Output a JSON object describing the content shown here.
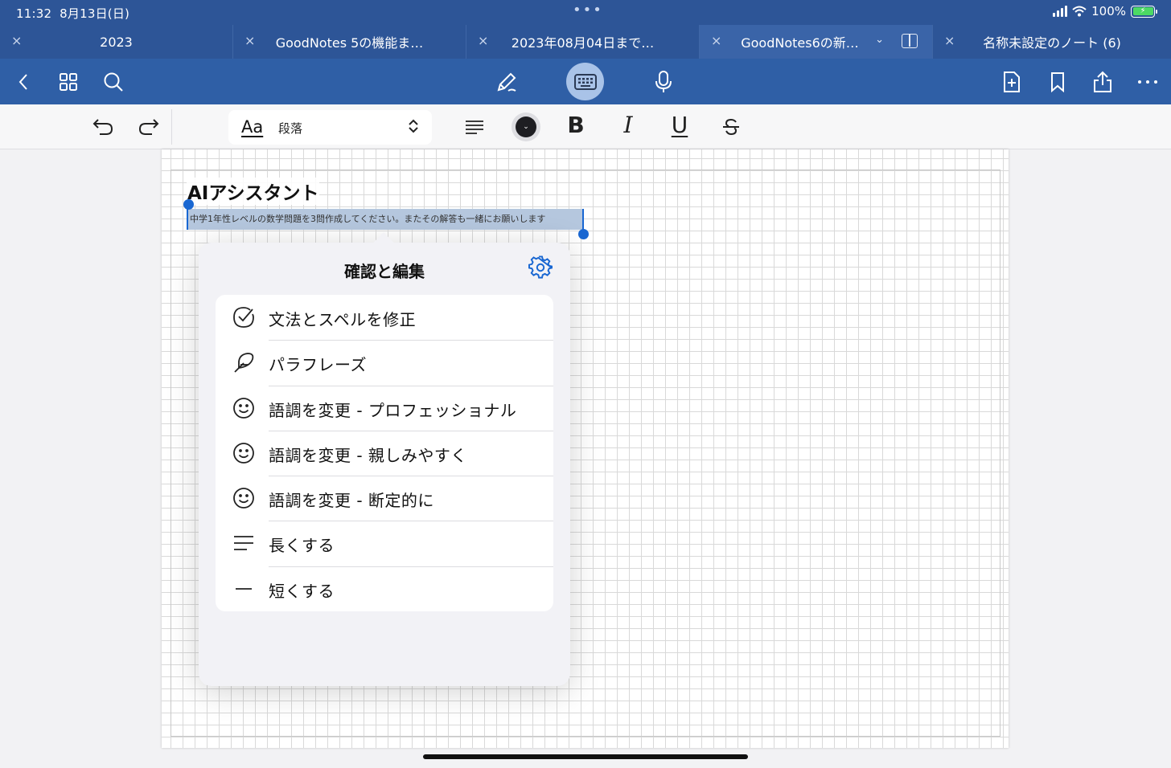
{
  "status_bar": {
    "time": "11:32",
    "date": "8月13日(日)",
    "dots": "•••",
    "battery": "100%"
  },
  "tabs": [
    {
      "label": "2023",
      "active": false
    },
    {
      "label": "GoodNotes 5の機能ま…",
      "active": false
    },
    {
      "label": "2023年08月04日まで…",
      "active": false
    },
    {
      "label": "GoodNotes6の新…",
      "active": true
    },
    {
      "label": "名称未設定のノート (6)",
      "active": false
    }
  ],
  "tab_close": "×",
  "toolbar": {
    "paragraph_style": "段落",
    "aa": "Aa",
    "bold": "B",
    "italic": "I",
    "underline": "U"
  },
  "note": {
    "title": "AIアシスタント",
    "selected_text": "中学1年性レベルの数学問題を3問作成してください。またその解答も一緒にお願いします"
  },
  "popover": {
    "title": "確認と編集",
    "items": [
      {
        "label": "文法とスペルを修正",
        "icon": "checkmark-circle-icon"
      },
      {
        "label": "パラフレーズ",
        "icon": "feather-icon"
      },
      {
        "label": "語調を変更 - プロフェッショナル",
        "icon": "smiley-icon"
      },
      {
        "label": "語調を変更 - 親しみやすく",
        "icon": "smiley-icon"
      },
      {
        "label": "語調を変更 - 断定的に",
        "icon": "smiley-icon"
      },
      {
        "label": "長くする",
        "icon": "lines-icon"
      },
      {
        "label": "短くする",
        "icon": "dash-icon"
      }
    ]
  },
  "colors": {
    "chrome": "#2d5597",
    "accent": "#1967d2",
    "selection": "#b5c7de"
  }
}
